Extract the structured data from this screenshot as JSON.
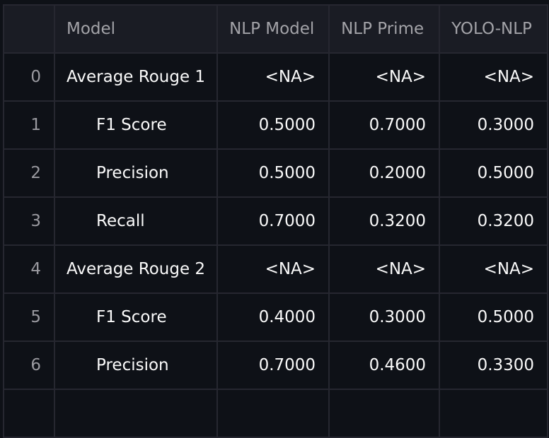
{
  "table": {
    "columns": [
      "",
      "Model",
      "NLP Model",
      "NLP Prime",
      "YOLO-NLP"
    ],
    "rows": [
      {
        "index": "0",
        "model": "Average Rouge 1",
        "indent": false,
        "values": [
          "<NA>",
          "<NA>",
          "<NA>"
        ]
      },
      {
        "index": "1",
        "model": "F1 Score",
        "indent": true,
        "values": [
          "0.5000",
          "0.7000",
          "0.3000"
        ]
      },
      {
        "index": "2",
        "model": "Precision",
        "indent": true,
        "values": [
          "0.5000",
          "0.2000",
          "0.5000"
        ]
      },
      {
        "index": "3",
        "model": "Recall",
        "indent": true,
        "values": [
          "0.7000",
          "0.3200",
          "0.3200"
        ]
      },
      {
        "index": "4",
        "model": "Average Rouge 2",
        "indent": false,
        "values": [
          "<NA>",
          "<NA>",
          "<NA>"
        ]
      },
      {
        "index": "5",
        "model": "F1 Score",
        "indent": true,
        "values": [
          "0.4000",
          "0.3000",
          "0.5000"
        ]
      },
      {
        "index": "6",
        "model": "Precision",
        "indent": true,
        "values": [
          "0.7000",
          "0.4600",
          "0.3300"
        ]
      },
      {
        "index": "",
        "model": "",
        "indent": true,
        "values": [
          "",
          "",
          ""
        ]
      }
    ]
  },
  "colors": {
    "background": "#0e1117",
    "header_bg": "#1a1c24",
    "grid": "#262730",
    "text": "#fafafa",
    "muted_text": "#a3a3a8"
  }
}
